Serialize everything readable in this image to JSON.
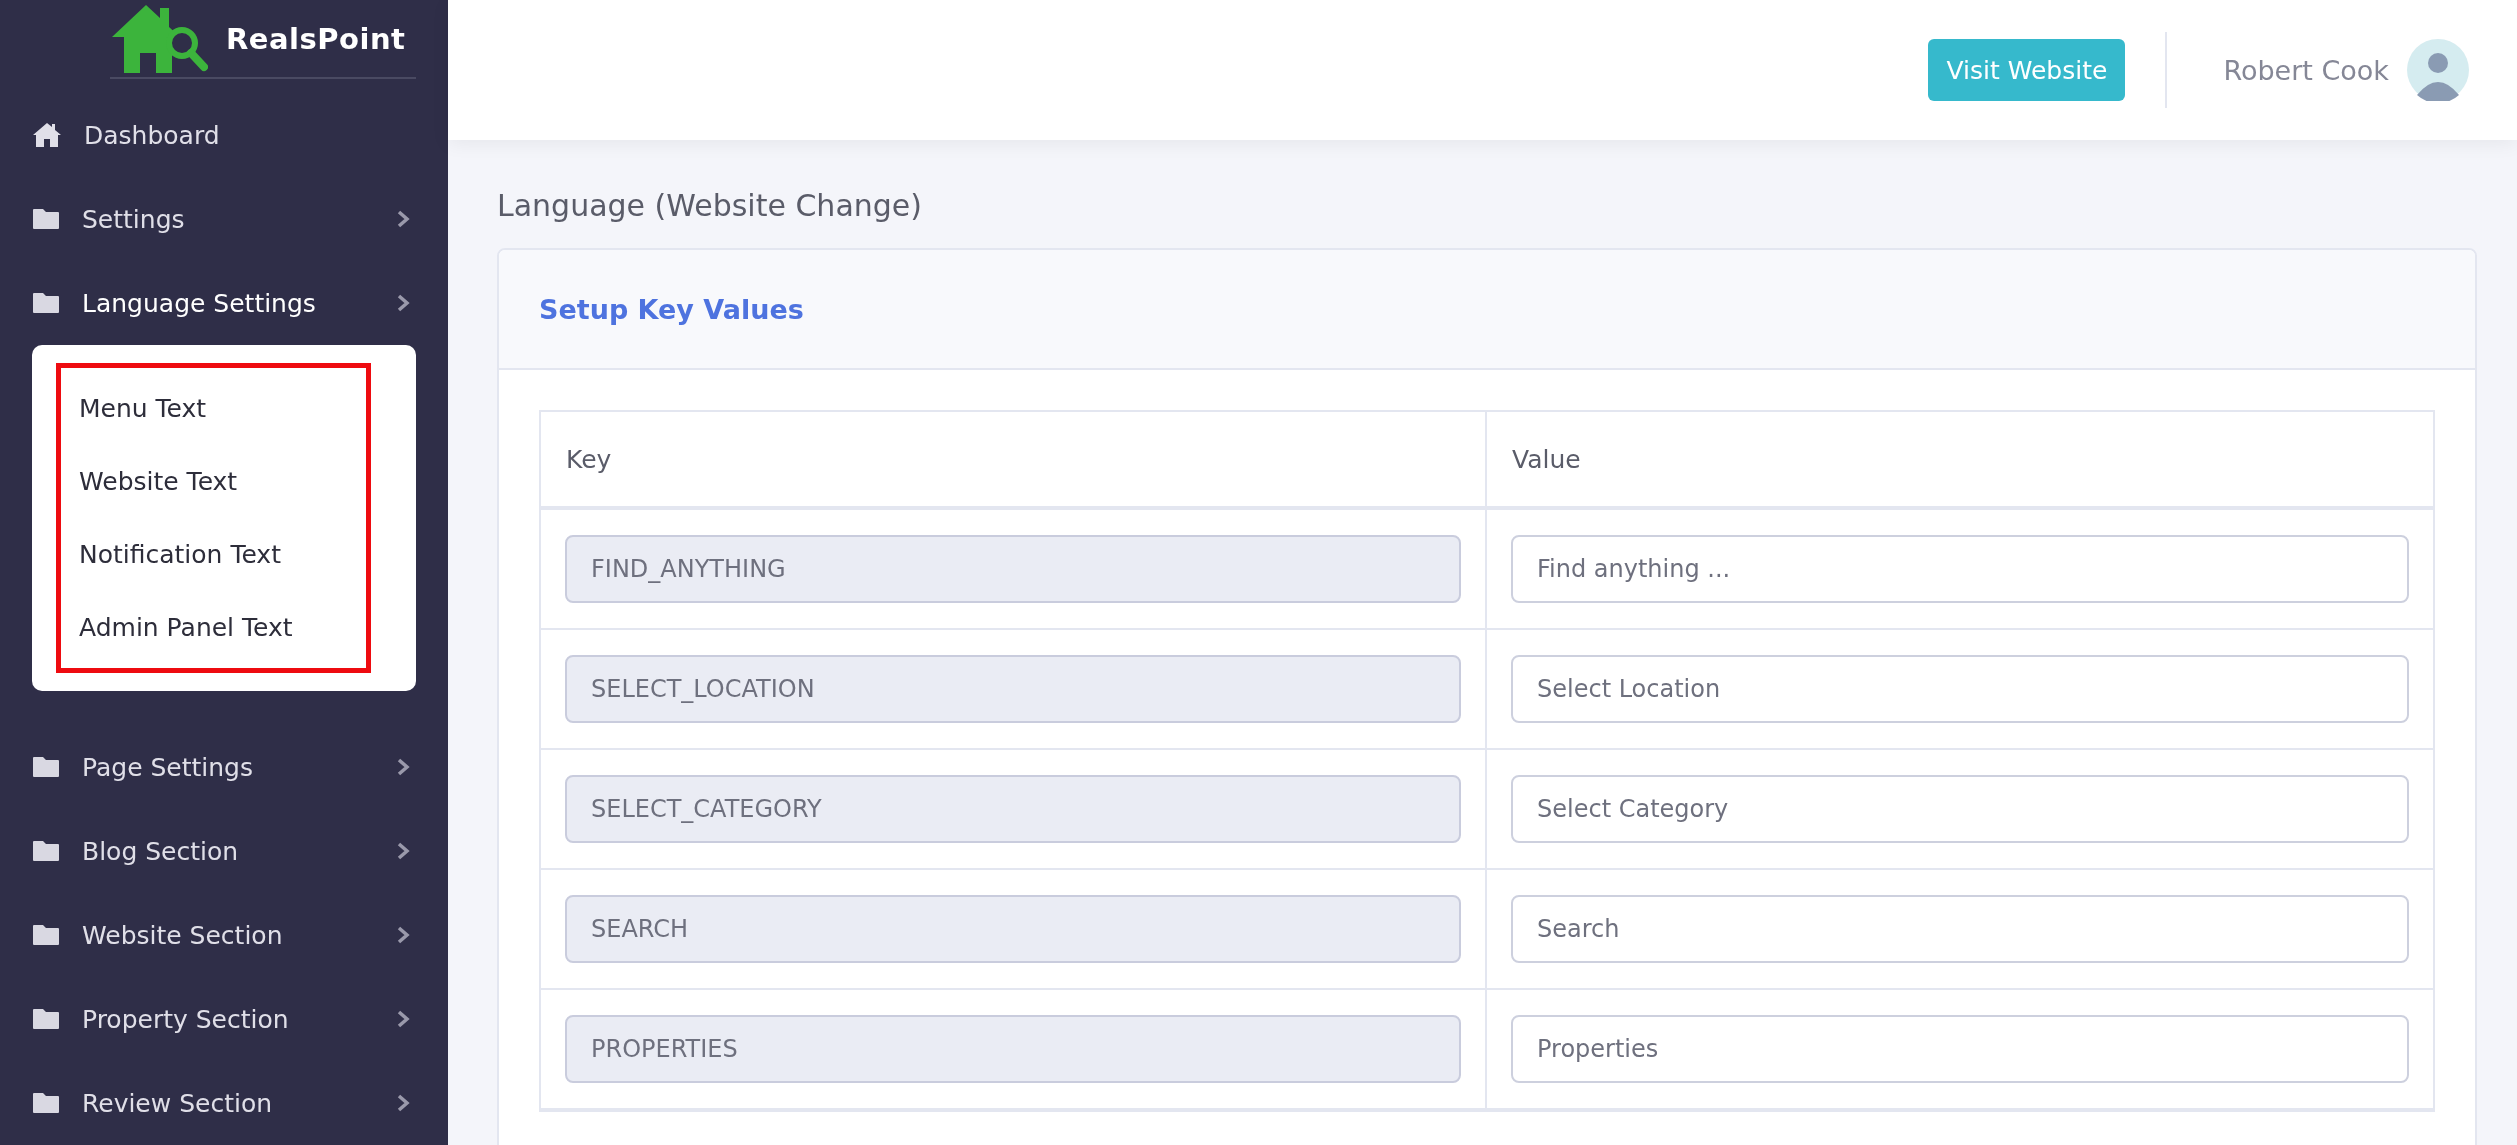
{
  "brand": {
    "name": "RealsPoint"
  },
  "sidebar": {
    "items": [
      {
        "label": "Dashboard",
        "kind": "link"
      },
      {
        "label": "Settings",
        "kind": "group",
        "expanded": false
      },
      {
        "label": "Language Settings",
        "kind": "group",
        "expanded": true,
        "highlighted": true,
        "children": [
          {
            "label": "Menu Text"
          },
          {
            "label": "Website Text"
          },
          {
            "label": "Notification Text"
          },
          {
            "label": "Admin Panel Text"
          }
        ]
      },
      {
        "label": "Page Settings",
        "kind": "group",
        "expanded": false
      },
      {
        "label": "Blog Section",
        "kind": "group",
        "expanded": false
      },
      {
        "label": "Website Section",
        "kind": "group",
        "expanded": false
      },
      {
        "label": "Property Section",
        "kind": "group",
        "expanded": false
      },
      {
        "label": "Review Section",
        "kind": "group",
        "expanded": false
      }
    ]
  },
  "header": {
    "button": "Visit Website",
    "user": "Robert Cook"
  },
  "page": {
    "title": "Language (Website Change)"
  },
  "card": {
    "title": "Setup Key Values"
  },
  "table": {
    "columns": [
      "Key",
      "Value"
    ],
    "rows": [
      {
        "key": "FIND_ANYTHING",
        "value": "Find anything ..."
      },
      {
        "key": "SELECT_LOCATION",
        "value": "Select Location"
      },
      {
        "key": "SELECT_CATEGORY",
        "value": "Select Category"
      },
      {
        "key": "SEARCH",
        "value": "Search"
      },
      {
        "key": "PROPERTIES",
        "value": "Properties"
      }
    ]
  }
}
